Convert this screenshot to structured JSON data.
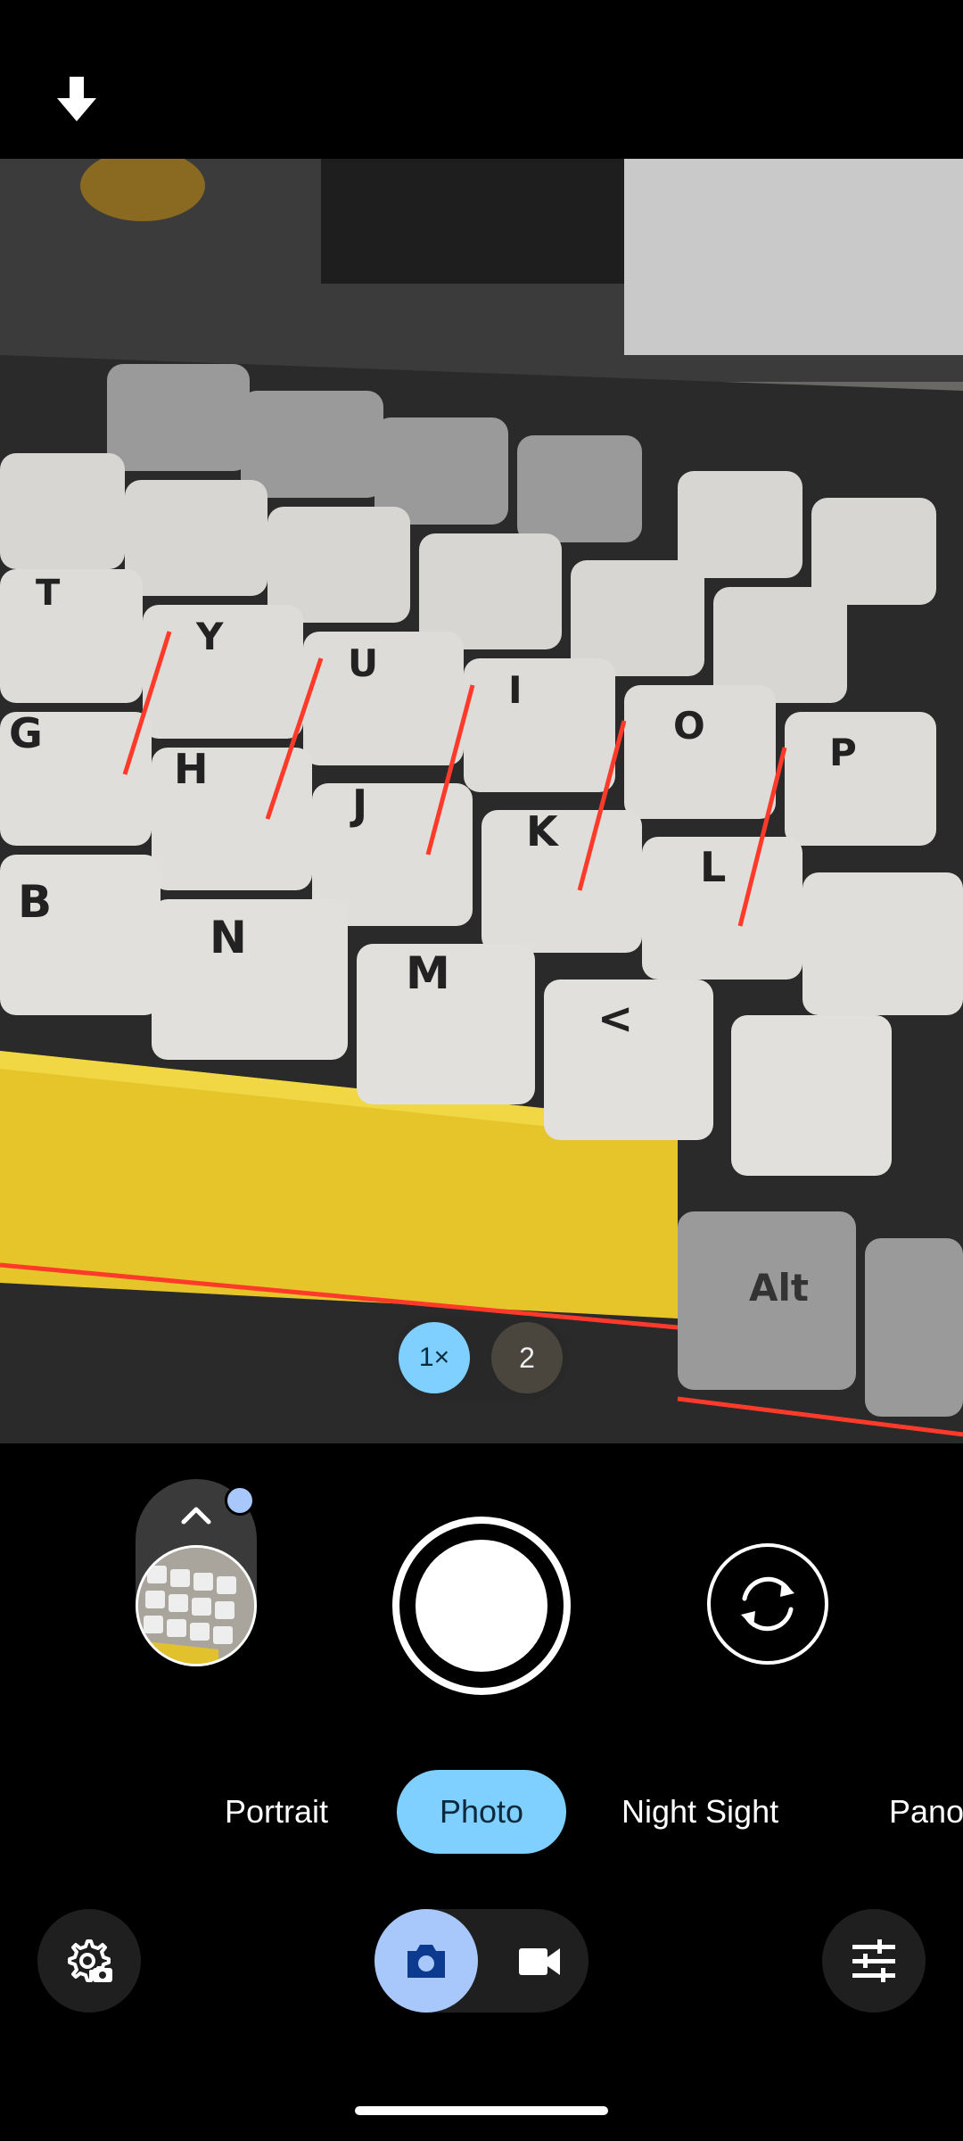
{
  "app": "Camera",
  "zoom": {
    "options": [
      "1×",
      "2"
    ],
    "selected": "1×"
  },
  "modes": [
    "Portrait",
    "Photo",
    "Night Sight",
    "Pano"
  ],
  "selected_mode": "Photo",
  "capture_type": {
    "options": [
      "photo",
      "video"
    ],
    "selected": "photo"
  },
  "icons": {
    "top_left": "download-arrow-icon",
    "gallery": "chevron-up-icon",
    "flip": "switch-camera-icon",
    "settings": "camera-settings-icon",
    "photo": "camera-icon",
    "video": "videocam-icon",
    "adjust": "tune-icon"
  },
  "viewfinder_keys": [
    "T",
    "Y",
    "U",
    "I",
    "O",
    "G",
    "H",
    "J",
    "K",
    "L",
    "P",
    "B",
    "N",
    "M",
    "<",
    "Alt"
  ],
  "colors": {
    "accent": "#7fcfff",
    "accent_secondary": "#a8c7fa",
    "background": "#000000"
  }
}
